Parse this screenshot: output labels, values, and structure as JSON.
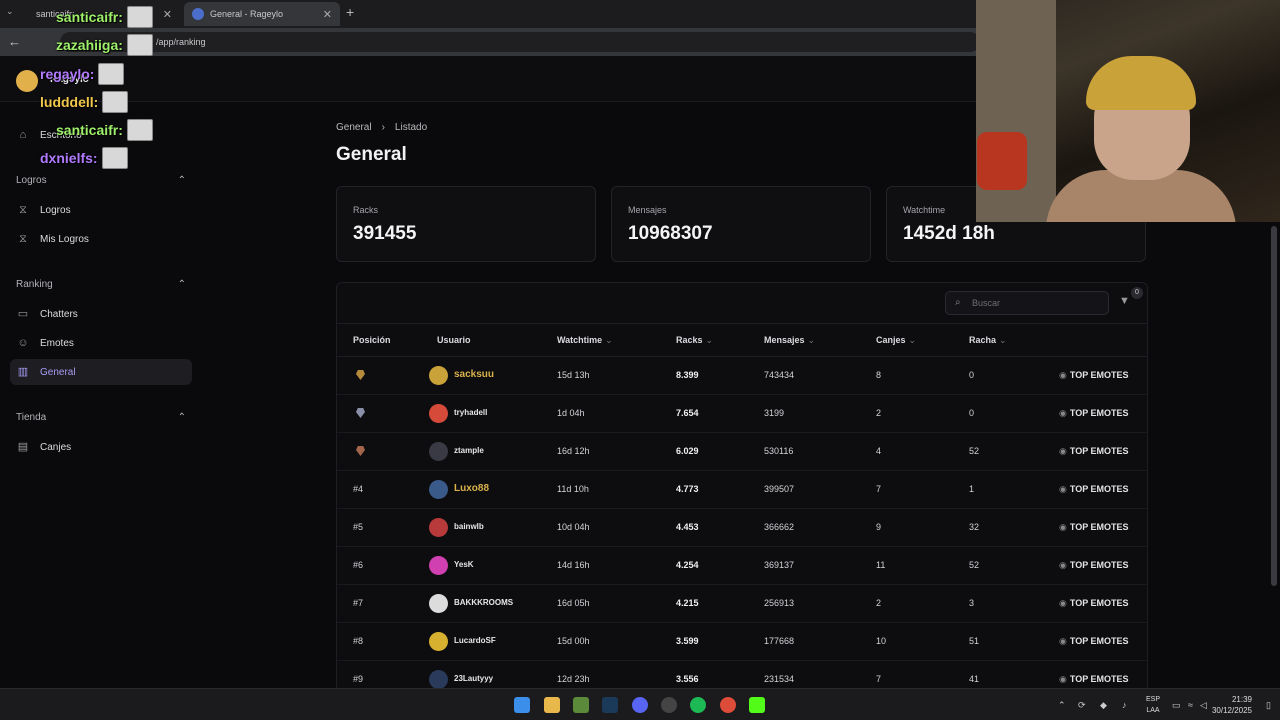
{
  "browser": {
    "tab1": {
      "title": "santicaifr:"
    },
    "tab2": {
      "title": "General - Rageylo"
    },
    "url": "/app/ranking"
  },
  "header": {
    "username": "Rageylo"
  },
  "sidebar": {
    "escritorio": "Escritorio",
    "sections": [
      {
        "title": "Logros",
        "items": [
          "Logros",
          "Mis Logros"
        ]
      },
      {
        "title": "Ranking",
        "items": [
          "Chatters",
          "Emotes",
          "General"
        ]
      },
      {
        "title": "Tienda",
        "items": [
          "Canjes"
        ]
      }
    ],
    "active": "General"
  },
  "chat_overlay": [
    {
      "user": "santicaifr:",
      "color": "#9ef06a"
    },
    {
      "user": "zazahiiga:",
      "color": "#9ef06a"
    },
    {
      "user": "regaylo:",
      "color": "#b27bff"
    },
    {
      "user": "ludddell:",
      "color": "#f2c84b"
    },
    {
      "user": "santicaifr:",
      "color": "#9ef06a"
    },
    {
      "user": "dxnielfs:",
      "color": "#b27bff"
    }
  ],
  "main": {
    "breadcrumb": [
      "General",
      "Listado"
    ],
    "title": "General",
    "stats": [
      {
        "label": "Racks",
        "value": "391455"
      },
      {
        "label": "Mensajes",
        "value": "10968307"
      },
      {
        "label": "Watchtime",
        "value": "1452d 18h"
      }
    ],
    "search_placeholder": "Buscar",
    "filter_count": "0",
    "columns": [
      "Posición",
      "Usuario",
      "Watchtime",
      "Racks",
      "Mensajes",
      "Canjes",
      "Racha"
    ],
    "top_emotes_label": "TOP EMOTES",
    "rows": [
      {
        "pos": "",
        "medal": "gold",
        "user": "sacksuu",
        "highlight": true,
        "watchtime": "15d 13h",
        "racks": "8.399",
        "mensajes": "743434",
        "canjes": "8",
        "racha": "0"
      },
      {
        "pos": "",
        "medal": "silver",
        "user": "tryhadell",
        "highlight": false,
        "watchtime": "1d 04h",
        "racks": "7.654",
        "mensajes": "3199",
        "canjes": "2",
        "racha": "0"
      },
      {
        "pos": "",
        "medal": "bronze",
        "user": "ztample",
        "highlight": false,
        "watchtime": "16d 12h",
        "racks": "6.029",
        "mensajes": "530116",
        "canjes": "4",
        "racha": "52"
      },
      {
        "pos": "#4",
        "user": "Luxo88",
        "highlight": true,
        "watchtime": "11d 10h",
        "racks": "4.773",
        "mensajes": "399507",
        "canjes": "7",
        "racha": "1"
      },
      {
        "pos": "#5",
        "user": "bainwlb",
        "highlight": false,
        "watchtime": "10d 04h",
        "racks": "4.453",
        "mensajes": "366662",
        "canjes": "9",
        "racha": "32"
      },
      {
        "pos": "#6",
        "user": "YesK",
        "highlight": false,
        "watchtime": "14d 16h",
        "racks": "4.254",
        "mensajes": "369137",
        "canjes": "11",
        "racha": "52"
      },
      {
        "pos": "#7",
        "user": "BAKKKROOMS",
        "highlight": false,
        "watchtime": "16d 05h",
        "racks": "4.215",
        "mensajes": "256913",
        "canjes": "2",
        "racha": "3"
      },
      {
        "pos": "#8",
        "user": "LucardoSF",
        "highlight": false,
        "watchtime": "15d 00h",
        "racks": "3.599",
        "mensajes": "177668",
        "canjes": "10",
        "racha": "51"
      },
      {
        "pos": "#9",
        "user": "23Lautyyy",
        "highlight": false,
        "watchtime": "12d 23h",
        "racks": "3.556",
        "mensajes": "231534",
        "canjes": "7",
        "racha": "41"
      }
    ]
  },
  "taskbar": {
    "lang": [
      "ESP",
      "LAA"
    ],
    "time": "21:39",
    "date": "30/12/2025"
  }
}
